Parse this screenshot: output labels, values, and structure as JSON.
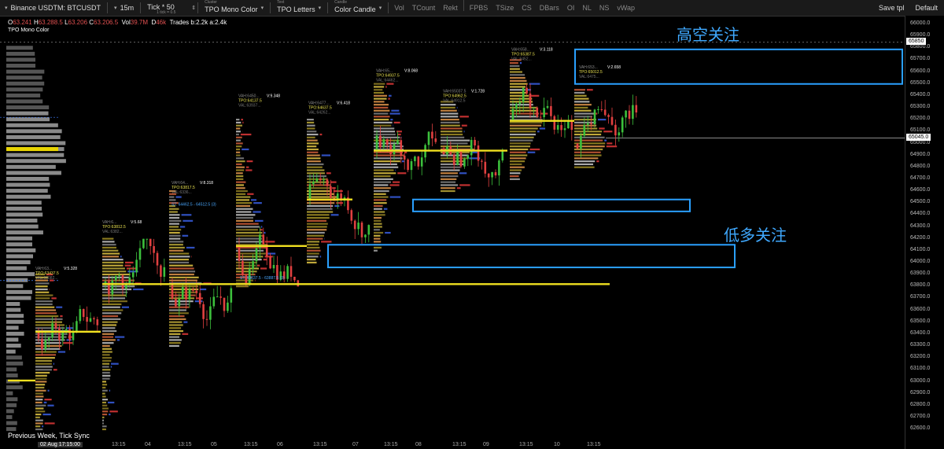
{
  "toolbar": {
    "symbol": "Binance USDTM: BTCUSDT",
    "interval": "15m",
    "tick": "Tick * 50",
    "tick_sub": "1 tick = 0.5",
    "cluster_caption": "Cluster",
    "cluster_value": "TPO Mono Color",
    "text_caption": "Text",
    "text_value": "TPO Letters",
    "candle_caption": "Candle",
    "candle_value": "Color Candle",
    "toggles": [
      "Vol",
      "TCount",
      "Rekt",
      "FPBS",
      "TSize",
      "CS",
      "DBars",
      "OI",
      "NL",
      "NS",
      "vWap"
    ],
    "save_label": "Save tpl",
    "default_label": "Default"
  },
  "ohlc": {
    "o": "63.241",
    "h": "63.288.5",
    "l": "63.206",
    "c": "63.206.5",
    "vol": "39.7M",
    "d": "46k",
    "trades": "Trades b:2.2k a:2.4k"
  },
  "indicator_label": "TPO Mono Color",
  "footer_label": "Previous Week, Tick Sync",
  "current_price": "65045.0",
  "marked_price": "65850",
  "price_ticks": [
    "66000.0",
    "65900.0",
    "65800.0",
    "65700.0",
    "65600.0",
    "65500.0",
    "65400.0",
    "65300.0",
    "65200.0",
    "65100.0",
    "65000.0",
    "64900.0",
    "64800.0",
    "64700.0",
    "64600.0",
    "64500.0",
    "64400.0",
    "64300.0",
    "64200.0",
    "64100.0",
    "64000.0",
    "63900.0",
    "63800.0",
    "63700.0",
    "63600.0",
    "63500.0",
    "63400.0",
    "63300.0",
    "63200.0",
    "63100.0",
    "63000.0",
    "62900.0",
    "62800.0",
    "62700.0",
    "62600.0"
  ],
  "time_ticks": [
    "02 Aug 17:15:00",
    "13:15",
    "04",
    "13:15",
    "05",
    "13:15",
    "06",
    "13:15",
    "07",
    "13:15",
    "08",
    "13:15",
    "09",
    "13:15",
    "10",
    "13:15"
  ],
  "annotations": {
    "short_watch": "高空关注",
    "long_watch": "低多关注"
  },
  "session_labels": [
    {
      "vah": "VAH:63...",
      "v": "V:5.328",
      "tpo": "TPO:63437.5",
      "val": "VAL:63082..."
    },
    {
      "vah": "VAH:6...",
      "v": "V:5.68",
      "tpo": "TPO:63812.5",
      "val": "VAL:6382..."
    },
    {
      "vah": "VAH:64...",
      "v": "V:8.318",
      "tpo": "TPO:63817.5",
      "val": "VAL:6336..."
    },
    {
      "vah": "VAH:6450...",
      "v": "V:9.348",
      "tpo": "TPO:64137.5",
      "val": "VAL:63937..."
    },
    {
      "vah": "VAH:6477...",
      "v": "V:6.418",
      "tpo": "TPO:64637.5",
      "val": "VAL:64262..."
    },
    {
      "vah": "VAH:65...",
      "v": "V:8.068",
      "tpo": "TPO:64937.5",
      "val": "VAL:64462..."
    },
    {
      "vah": "VAH:65037.5",
      "v": "V:1.728",
      "tpo": "TPO:64962.5",
      "val": "VAL:64912.5"
    },
    {
      "vah": "VAH:658...",
      "v": "V:3.118",
      "tpo": "TPO:65387.5",
      "val": "VAL:6452..."
    },
    {
      "vah": "VAH:653...",
      "v": "V:2.658",
      "tpo": "TPO:65012.5",
      "val": "VAL:6475..."
    }
  ],
  "range_labels": [
    "ST: 64462.5 - 64512.5 (3)",
    "ST: 63837.5 - 63887.5 (3)"
  ]
}
